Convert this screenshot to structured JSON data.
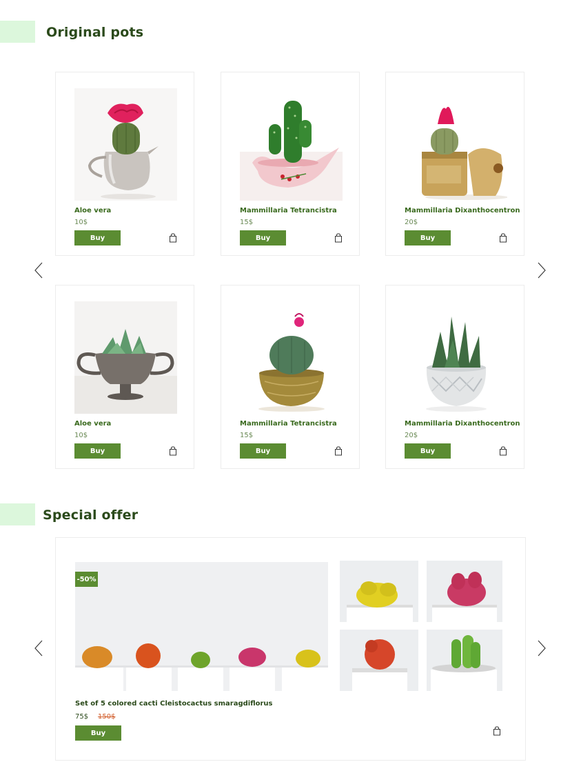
{
  "sections": {
    "original": {
      "title": "Original pots"
    },
    "special": {
      "title": "Special offer"
    }
  },
  "products": [
    {
      "name": "Aloe vera",
      "price": "10$",
      "buy": "Buy"
    },
    {
      "name": "Mammillaria Tetrancistra",
      "price": "15$",
      "buy": "Buy"
    },
    {
      "name": "Mammillaria Dixanthocentron",
      "price": "20$",
      "buy": "Buy"
    },
    {
      "name": "Aloe vera",
      "price": "10$",
      "buy": "Buy"
    },
    {
      "name": "Mammillaria Tetrancistra",
      "price": "15$",
      "buy": "Buy"
    },
    {
      "name": "Mammillaria Dixanthocentron",
      "price": "20$",
      "buy": "Buy"
    }
  ],
  "offer": {
    "badge": "-50%",
    "name": "Set of 5 colored cacti Cleistocactus smaragdiflorus",
    "price": "75$",
    "old_price": "150$",
    "buy": "Buy"
  },
  "colors": {
    "accent": "#5b8c32",
    "accent_bar": "#dcf7dc",
    "title": "#2b4a1b",
    "old_price": "#d2602f"
  },
  "icons": [
    "chevron-left-icon",
    "chevron-right-icon",
    "shopping-bag-icon"
  ]
}
